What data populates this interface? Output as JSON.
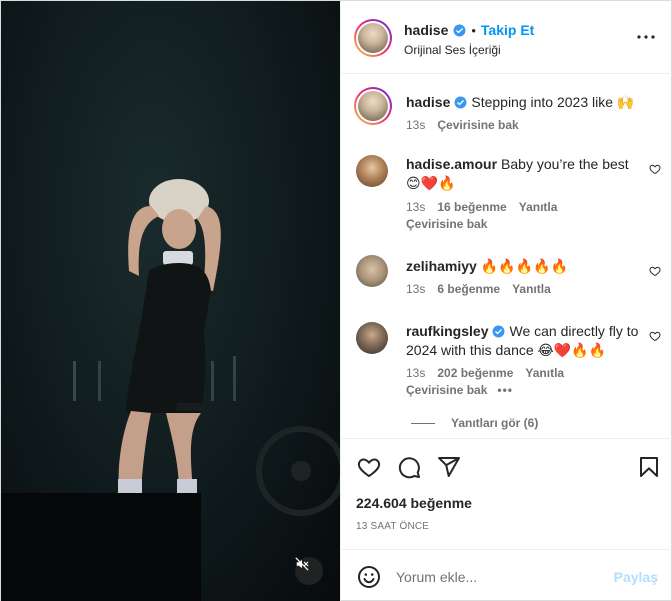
{
  "header": {
    "username": "hadise",
    "separator": "•",
    "follow_label": "Takip Et",
    "audio_label": "Orijinal Ses İçeriği"
  },
  "caption": {
    "username": "hadise",
    "text": "Stepping into 2023 like 🙌",
    "time": "13s",
    "translate_label": "Çevirisine bak"
  },
  "comments": [
    {
      "username": "hadise.amour",
      "text": "Baby you’re the best 😊❤️🔥",
      "time": "13s",
      "likes": "16 beğenme",
      "reply_label": "Yanıtla",
      "translate_label": "Çevirisine bak"
    },
    {
      "username": "zelihamiyy",
      "text": "🔥🔥🔥🔥🔥",
      "time": "13s",
      "likes": "6 beğenme",
      "reply_label": "Yanıtla"
    },
    {
      "username": "raufkingsley",
      "text": "We can directly fly to 2024 with this dance 😂❤️🔥🔥",
      "time": "13s",
      "likes": "202 beğenme",
      "reply_label": "Yanıtla",
      "translate_label": "Çevirisine bak",
      "more": "•••",
      "view_replies": "Yanıtları gör (6)"
    }
  ],
  "post": {
    "likes_count": "224.604 beğenme",
    "timestamp": "13 SAAT ÖNCE"
  },
  "comment_box": {
    "placeholder": "Yorum ekle...",
    "post_label": "Paylaş"
  },
  "colors": {
    "accent": "#0095f6",
    "verified": "#3897f0",
    "secondary_text": "#737373",
    "disabled_post": "#b2dffc"
  },
  "icons": {
    "more": "more-horizontal-icon",
    "like": "heart-icon",
    "comment": "comment-icon",
    "share": "send-icon",
    "save": "bookmark-icon",
    "emoji": "emoji-icon",
    "mute": "muted-speaker-icon"
  }
}
